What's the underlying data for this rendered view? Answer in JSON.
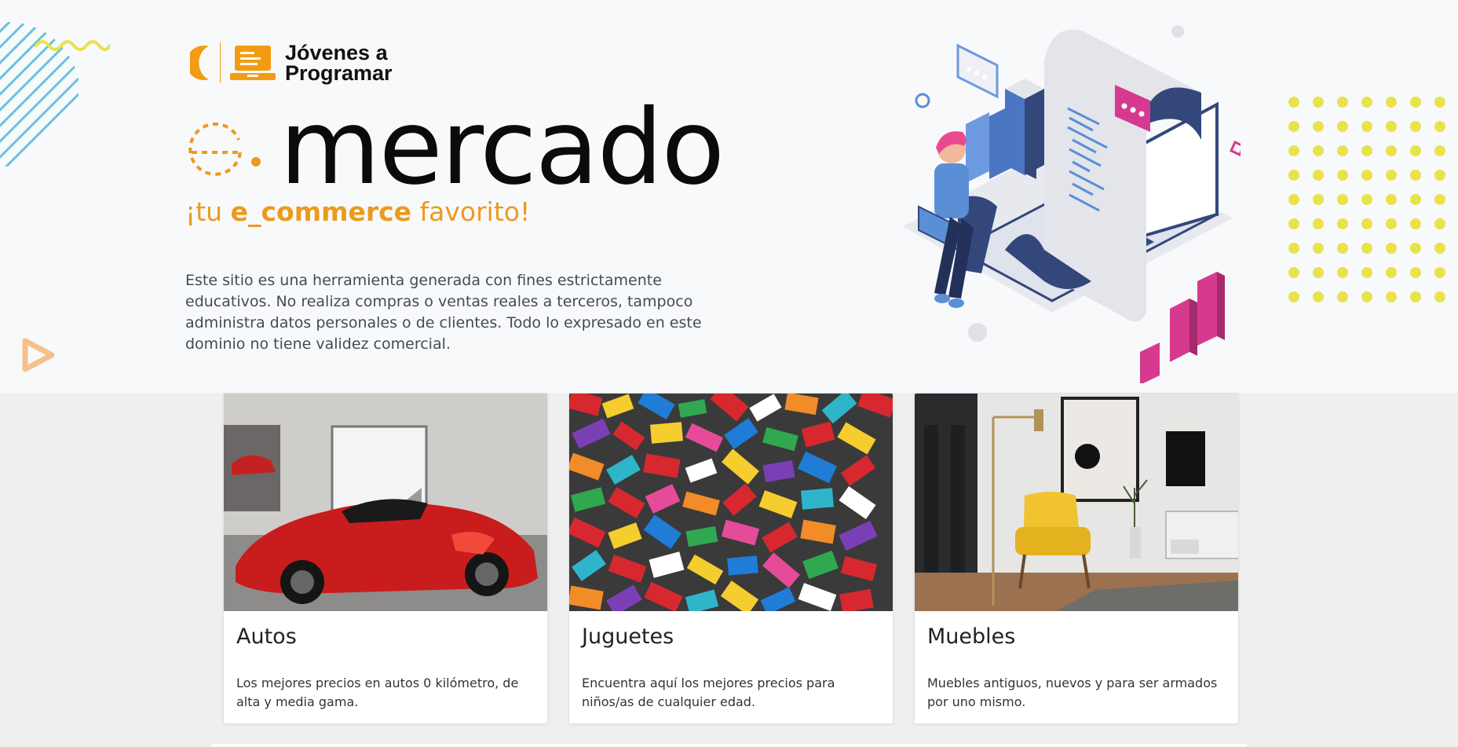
{
  "header": {
    "logo_line1": "Jóvenes a",
    "logo_line2": "Programar",
    "brand_name": "mercado",
    "tagline_pre": "¡tu ",
    "tagline_bold": "e_commerce",
    "tagline_post": " favorito!",
    "disclaimer": "Este sitio es una herramienta generada con fines estrictamente educativos. No realiza compras o ventas reales a terceros, tampoco administra datos personales o de clientes. Todo lo expresado en este dominio no tiene validez comercial."
  },
  "colors": {
    "accent": "#ec9a1e",
    "hero_bg": "#f8f9fb",
    "page_bg": "#efefef",
    "magenta": "#d63a8f",
    "navy": "#33477a",
    "yellow_dots": "#e9e24a",
    "stripes": "#6bc2e0"
  },
  "cards": [
    {
      "title": "Autos",
      "text": "Los mejores precios en autos 0 kilómetro, de alta y media gama.",
      "image": "red-sports-car-photo"
    },
    {
      "title": "Juguetes",
      "text": "Encuentra aquí los mejores precios para niños/as de cualquier edad.",
      "image": "colorful-lego-bricks-photo"
    },
    {
      "title": "Muebles",
      "text": "Muebles antiguos, nuevos y para ser armados por uno mismo.",
      "image": "yellow-armchair-room-photo"
    }
  ]
}
